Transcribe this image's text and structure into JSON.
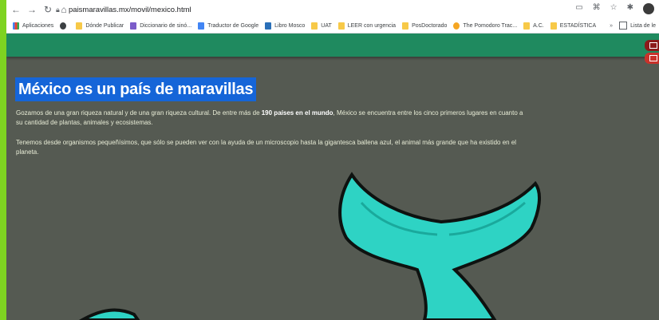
{
  "browser": {
    "url": "paismaravillas.mx/movil/mexico.html",
    "bookmarks": [
      {
        "label": "Aplicaciones",
        "icon": "apps-icon"
      },
      {
        "label": "",
        "icon": "globe-icon"
      },
      {
        "label": "Dónde Publicar",
        "icon": "folder-icon"
      },
      {
        "label": "Diccionario de sinó...",
        "icon": "dictionary-icon"
      },
      {
        "label": "Traductor de Google",
        "icon": "translate-icon"
      },
      {
        "label": "Libro Mosco",
        "icon": "book-icon"
      },
      {
        "label": "UAT",
        "icon": "folder-icon"
      },
      {
        "label": "LEER con urgencia",
        "icon": "folder-icon"
      },
      {
        "label": "PosDoctorado",
        "icon": "folder-icon"
      },
      {
        "label": "The Pomodoro Trac...",
        "icon": "pomodoro-icon"
      },
      {
        "label": "A.C.",
        "icon": "folder-icon"
      },
      {
        "label": "ESTADÍSTICA",
        "icon": "folder-icon"
      }
    ],
    "reading_list": "Lista de le"
  },
  "content": {
    "title": "México es un país de maravillas",
    "p1_before": "Gozamos de una gran riqueza natural y de una gran riqueza cultural. De entre más de ",
    "p1_bold": "190 países en el mundo",
    "p1_after": ", México se encuentra entre los cinco primeros lugares en cuanto a su cantidad de plantas, animales y ecosistemas.",
    "p2": "Tenemos desde organismos pequeñísimos, que sólo se pueden ver con la ayuda de un microscopio hasta la gigantesca ballena azul, el animal más grande que ha existido en el planeta."
  },
  "colors": {
    "banner": "#1f8a5f",
    "background": "#555a52",
    "title_highlight": "#1565d8",
    "whale": "#2ed3c4"
  }
}
